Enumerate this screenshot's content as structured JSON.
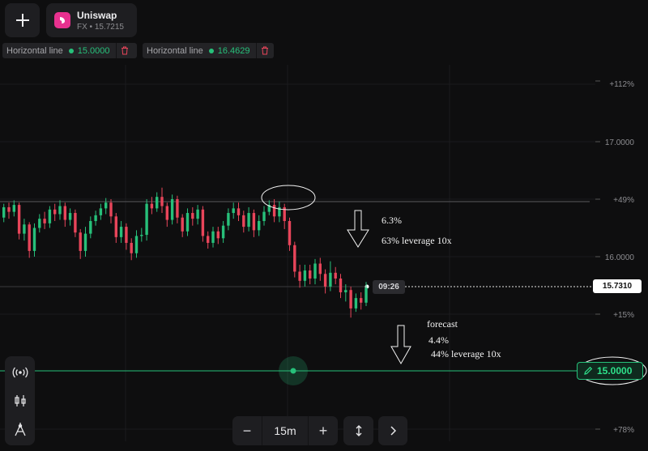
{
  "header": {
    "asset_name": "Uniswap",
    "asset_sub": "FX • 15.7215",
    "asset_logo_color": "#e8318f"
  },
  "horizontal_lines": [
    {
      "label": "Horizontal line",
      "value": "15.0000"
    },
    {
      "label": "Horizontal line",
      "value": "16.4629"
    }
  ],
  "axis": {
    "labels": [
      "+112%",
      "17.0000",
      "+49%",
      "16.0000",
      "+15%",
      "+78%"
    ]
  },
  "current_price": "15.7310",
  "timer": "09:26",
  "line_price": "15.0000",
  "annotations": {
    "a1": "6.3%",
    "a2": "63% leverage 10x",
    "a3": "forecast",
    "a4": "4.4%",
    "a5": "44% leverage 10x"
  },
  "toolbar": {
    "timeframe": "15m",
    "minus": "−",
    "plus": "+"
  },
  "colors": {
    "up": "#27c07a",
    "down": "#e8455a",
    "accent": "#27c07a",
    "background": "#0e0e0f"
  },
  "chart_data": {
    "type": "candlestick",
    "price_range": [
      14.7,
      17.5
    ],
    "horizontal_lines": [
      15.0,
      16.4629
    ],
    "current_price": 15.731,
    "candles": [
      [
        16.34,
        16.43,
        16.46,
        16.3
      ],
      [
        16.43,
        16.39,
        16.47,
        16.33
      ],
      [
        16.39,
        16.45,
        16.49,
        16.35
      ],
      [
        16.45,
        16.2,
        16.47,
        16.15
      ],
      [
        16.2,
        16.28,
        16.33,
        16.14
      ],
      [
        16.28,
        16.05,
        16.3,
        15.99
      ],
      [
        16.05,
        16.25,
        16.29,
        16.0
      ],
      [
        16.25,
        16.33,
        16.37,
        16.21
      ],
      [
        16.33,
        16.29,
        16.39,
        16.24
      ],
      [
        16.29,
        16.41,
        16.44,
        16.25
      ],
      [
        16.41,
        16.37,
        16.46,
        16.31
      ],
      [
        16.37,
        16.44,
        16.49,
        16.32
      ],
      [
        16.44,
        16.32,
        16.47,
        16.26
      ],
      [
        16.32,
        16.38,
        16.42,
        16.27
      ],
      [
        16.38,
        16.21,
        16.41,
        16.17
      ],
      [
        16.21,
        16.05,
        16.24,
        15.98
      ],
      [
        16.05,
        16.2,
        16.26,
        16.0
      ],
      [
        16.2,
        16.31,
        16.35,
        16.16
      ],
      [
        16.31,
        16.36,
        16.4,
        16.27
      ],
      [
        16.36,
        16.42,
        16.46,
        16.32
      ],
      [
        16.42,
        16.47,
        16.51,
        16.37
      ],
      [
        16.47,
        16.35,
        16.5,
        16.29
      ],
      [
        16.35,
        16.17,
        16.38,
        16.12
      ],
      [
        16.17,
        16.26,
        16.31,
        16.12
      ],
      [
        16.26,
        16.12,
        16.29,
        16.06
      ],
      [
        16.12,
        16.03,
        16.16,
        15.97
      ],
      [
        16.03,
        16.18,
        16.23,
        15.99
      ],
      [
        16.18,
        16.19,
        16.25,
        16.13
      ],
      [
        16.19,
        16.46,
        16.5,
        16.14
      ],
      [
        16.46,
        16.42,
        16.52,
        16.37
      ],
      [
        16.42,
        16.52,
        16.56,
        16.39
      ],
      [
        16.52,
        16.44,
        16.6,
        16.38
      ],
      [
        16.44,
        16.32,
        16.47,
        16.26
      ],
      [
        16.32,
        16.5,
        16.54,
        16.28
      ],
      [
        16.5,
        16.34,
        16.53,
        16.29
      ],
      [
        16.34,
        16.22,
        16.37,
        16.17
      ],
      [
        16.22,
        16.38,
        16.42,
        16.18
      ],
      [
        16.38,
        16.33,
        16.43,
        16.27
      ],
      [
        16.33,
        16.41,
        16.45,
        16.28
      ],
      [
        16.41,
        16.18,
        16.44,
        16.13
      ],
      [
        16.18,
        16.12,
        16.22,
        16.07
      ],
      [
        16.12,
        16.22,
        16.26,
        16.08
      ],
      [
        16.22,
        16.16,
        16.26,
        16.11
      ],
      [
        16.16,
        16.27,
        16.31,
        16.12
      ],
      [
        16.27,
        16.38,
        16.42,
        16.23
      ],
      [
        16.38,
        16.42,
        16.47,
        16.33
      ],
      [
        16.42,
        16.36,
        16.47,
        16.31
      ],
      [
        16.36,
        16.26,
        16.4,
        16.21
      ],
      [
        16.26,
        16.38,
        16.43,
        16.22
      ],
      [
        16.38,
        16.23,
        16.41,
        16.17
      ],
      [
        16.23,
        16.31,
        16.36,
        16.18
      ],
      [
        16.31,
        16.39,
        16.44,
        16.27
      ],
      [
        16.39,
        16.45,
        16.49,
        16.36
      ],
      [
        16.45,
        16.35,
        16.5,
        16.3
      ],
      [
        16.35,
        16.43,
        16.48,
        16.3
      ],
      [
        16.43,
        16.31,
        16.46,
        16.24
      ],
      [
        16.31,
        16.1,
        16.34,
        16.05
      ],
      [
        16.1,
        15.87,
        16.13,
        15.82
      ],
      [
        15.87,
        15.79,
        15.93,
        15.73
      ],
      [
        15.79,
        15.88,
        15.93,
        15.74
      ],
      [
        15.88,
        15.81,
        15.93,
        15.76
      ],
      [
        15.81,
        15.94,
        15.98,
        15.76
      ],
      [
        15.94,
        15.85,
        15.99,
        15.79
      ],
      [
        15.85,
        15.74,
        15.89,
        15.68
      ],
      [
        15.74,
        15.86,
        15.96,
        15.7
      ],
      [
        15.86,
        15.81,
        15.91,
        15.76
      ],
      [
        15.81,
        15.69,
        15.85,
        15.64
      ],
      [
        15.69,
        15.71,
        15.76,
        15.61
      ],
      [
        15.71,
        15.55,
        15.74,
        15.47
      ],
      [
        15.55,
        15.64,
        15.68,
        15.52
      ],
      [
        15.64,
        15.6,
        15.69,
        15.54
      ],
      [
        15.6,
        15.73,
        15.78,
        15.57
      ]
    ]
  }
}
